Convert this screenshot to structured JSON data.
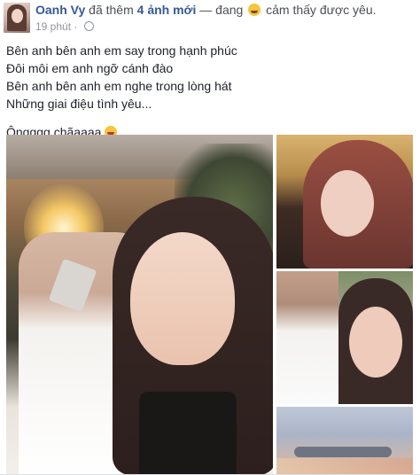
{
  "post": {
    "author": "Oanh Vy",
    "action_prefix": "đã thêm",
    "action_count_label": "4 ảnh mới",
    "feeling_prefix": "— đang",
    "feeling_text": "cảm thấy được yêu.",
    "timestamp": "19 phút ·",
    "privacy_icon": "globe-icon",
    "lines": [
      "Bên anh bên anh em say trong hạnh phúc",
      "Đôi môi em anh ngỡ cánh đào",
      "Bên anh bên anh em nghe trong lòng hát",
      "Những giai điệu tình yêu..."
    ],
    "closing_line": "Ôngggg chãaaaa"
  },
  "colors": {
    "author_link": "#365899",
    "text": "#1d2129",
    "muted": "#90949c"
  }
}
